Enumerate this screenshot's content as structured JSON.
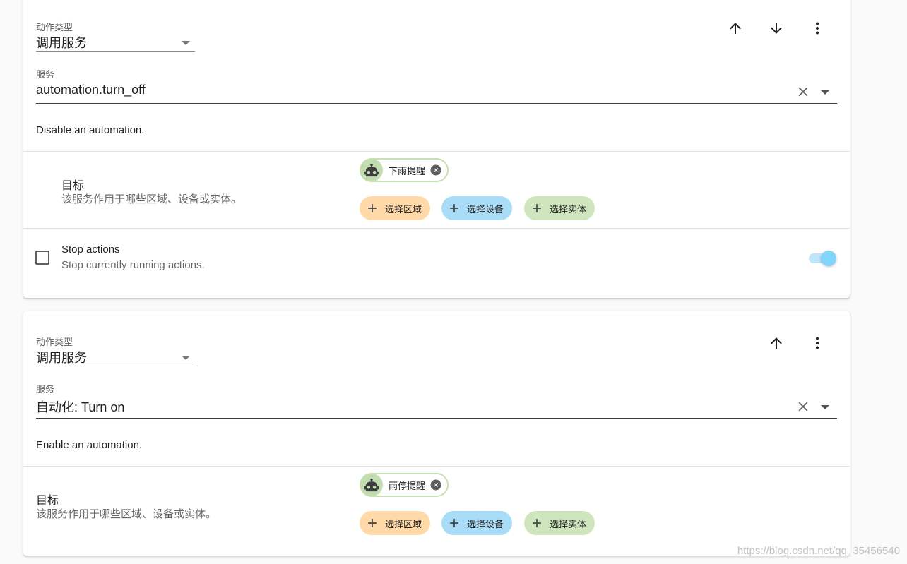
{
  "actions": [
    {
      "action_type_label": "动作类型",
      "action_type_value": "调用服务",
      "service_label": "服务",
      "service_value": "automation.turn_off",
      "service_description": "Disable an automation.",
      "target_title": "目标",
      "target_description": "该服务作用于哪些区域、设备或实体。",
      "selected_entity": "下雨提醒",
      "add_area": "选择区域",
      "add_device": "选择设备",
      "add_entity": "选择实体",
      "option_title": "Stop actions",
      "option_description": "Stop currently running actions.",
      "option_toggle_on": true
    },
    {
      "action_type_label": "动作类型",
      "action_type_value": "调用服务",
      "service_label": "服务",
      "service_value": "自动化: Turn on",
      "service_description": "Enable an automation.",
      "target_title": "目标",
      "target_description": "该服务作用于哪些区域、设备或实体。",
      "selected_entity": "雨停提醒",
      "add_area": "选择区域",
      "add_device": "选择设备",
      "add_entity": "选择实体"
    }
  ],
  "icons": {
    "move_up": "arrow-up-icon",
    "move_down": "arrow-down-icon",
    "overflow": "dots-vertical-icon",
    "clear": "close-icon",
    "dropdown": "menu-down-icon",
    "entity_avatar": "robot-icon",
    "chip_remove": "close-circle-icon",
    "add": "plus-icon"
  },
  "colors": {
    "accent": "#03a9f4",
    "toggle_thumb": "#81d4fa",
    "area_chip": "#ffd9a8",
    "device_chip": "#a9dcf6",
    "entity_chip": "#cfe5be"
  },
  "watermark": "https://blog.csdn.net/qq_35456540"
}
